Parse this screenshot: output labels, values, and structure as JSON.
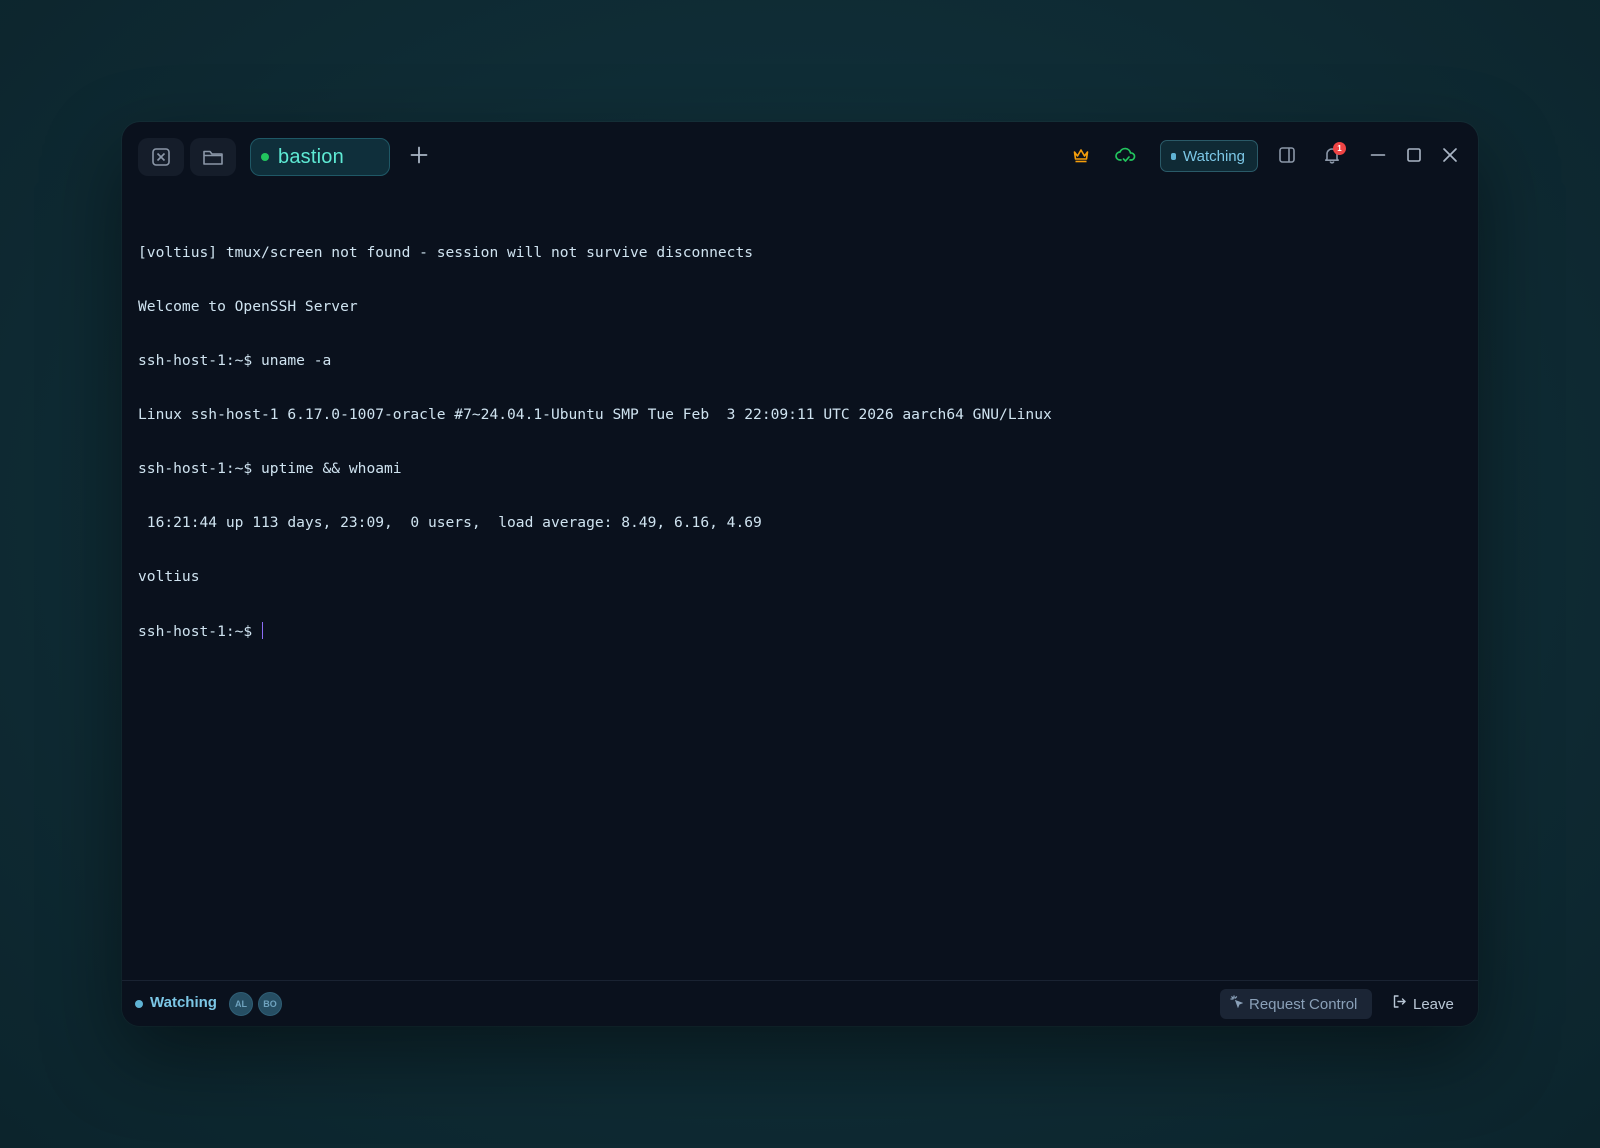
{
  "titlebar": {
    "tab": {
      "label": "bastion",
      "status_color": "#22c55e"
    },
    "watch_pill": {
      "label": "Watching"
    },
    "notifications": {
      "count": "1"
    },
    "icons": {
      "close_session": "x-square-icon",
      "files": "folder-icon",
      "new_tab": "plus-icon",
      "owner": "crown-icon",
      "sync": "cloud-sync-icon",
      "split": "panel-split-icon",
      "bell": "bell-icon",
      "minimize": "minimize-icon",
      "maximize": "maximize-icon",
      "close": "close-icon"
    }
  },
  "terminal": {
    "lines": [
      "[voltius] tmux/screen not found - session will not survive disconnects",
      "Welcome to OpenSSH Server",
      "ssh-host-1:~$ uname -a",
      "Linux ssh-host-1 6.17.0-1007-oracle #7~24.04.1-Ubuntu SMP Tue Feb  3 22:09:11 UTC 2026 aarch64 GNU/Linux",
      "ssh-host-1:~$ uptime && whoami",
      " 16:21:44 up 113 days, 23:09,  0 users,  load average: 8.49, 6.16, 4.69",
      "voltius"
    ],
    "prompt": "ssh-host-1:~$ "
  },
  "statusbar": {
    "status_label": "Watching",
    "viewers": [
      "AL",
      "BO"
    ],
    "request_control_label": "Request Control",
    "leave_label": "Leave"
  },
  "colors": {
    "accent_teal": "#5eead4",
    "watching_blue": "#7cc7e6",
    "online_green": "#22c55e",
    "crown_orange": "#f59e0b",
    "badge_red": "#ef4444",
    "cursor_purple": "#8b6cf5"
  }
}
